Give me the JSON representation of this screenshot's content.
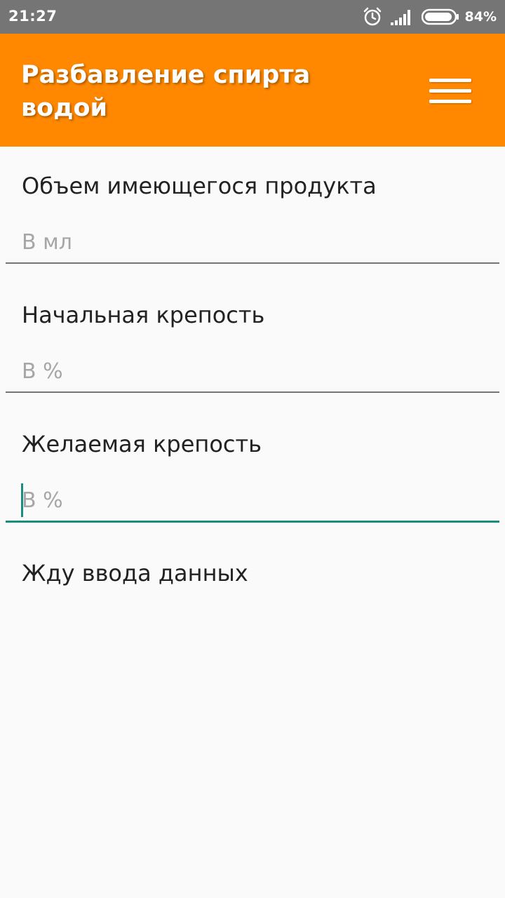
{
  "status_bar": {
    "time": "21:27",
    "battery_percent": "84%",
    "icons": [
      "alarm-icon",
      "signal-icon",
      "battery-icon"
    ]
  },
  "app_bar": {
    "title": "Разбавление спирта водой",
    "menu_icon": "hamburger-menu-icon",
    "color": "#ff8800"
  },
  "form": {
    "fields": [
      {
        "label": "Объем имеющегося продукта",
        "value": "",
        "placeholder": "В мл"
      },
      {
        "label": "Начальная крепость",
        "value": "",
        "placeholder": "В %"
      },
      {
        "label": "Желаемая крепость",
        "value": "",
        "placeholder": "В %"
      }
    ],
    "focused_field_index": 2,
    "accent_color": "#1a8c80"
  },
  "result": {
    "text": "Жду ввода данных"
  }
}
